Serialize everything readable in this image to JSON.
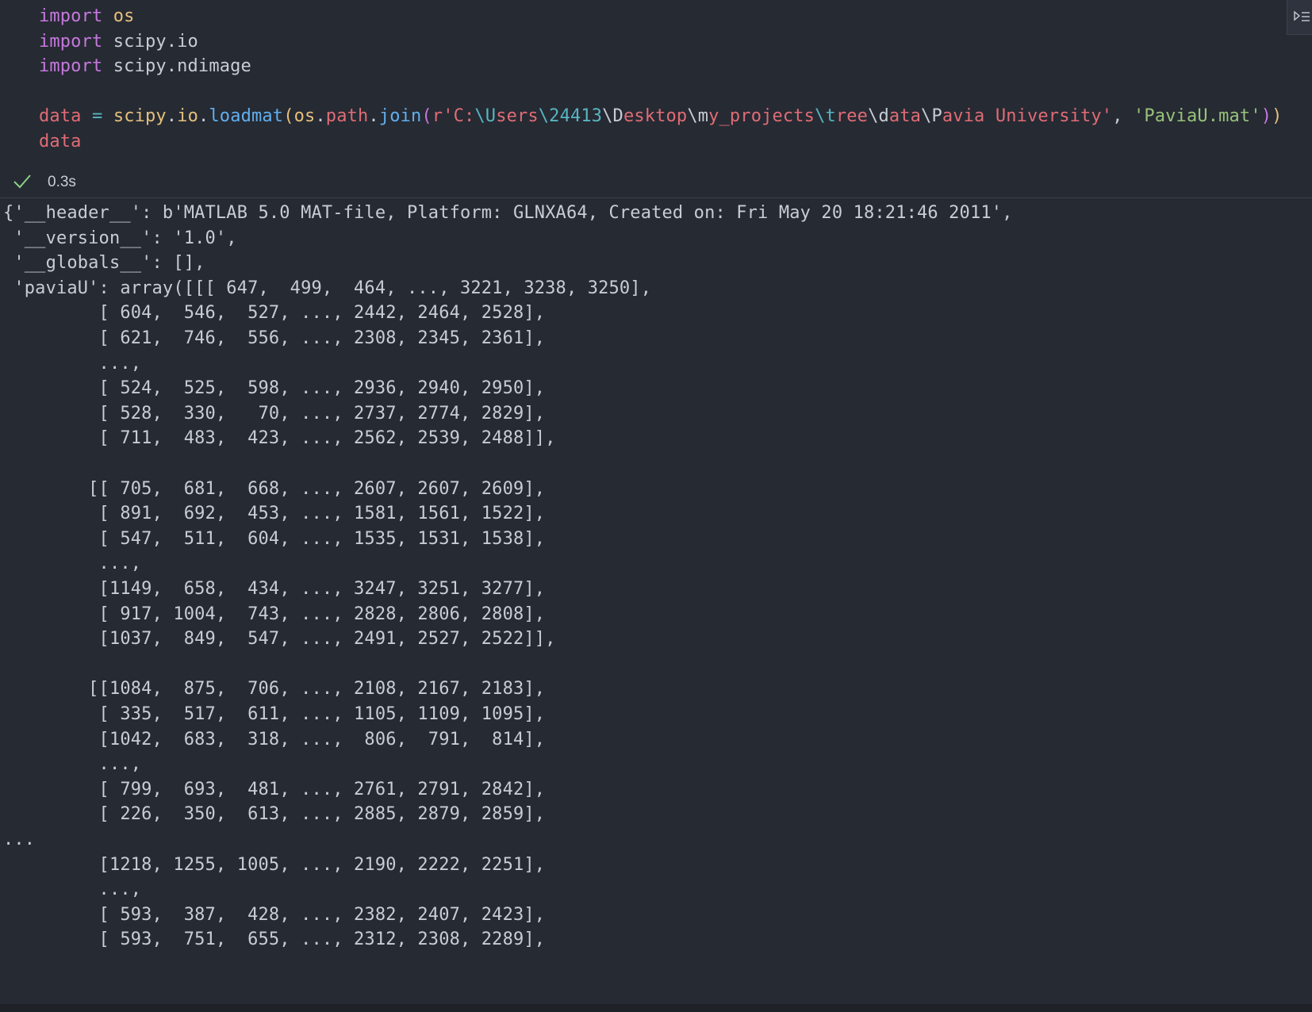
{
  "code_cell": {
    "lines": [
      {
        "tokens": [
          {
            "t": "import",
            "c": "kw"
          },
          {
            "t": " ",
            "c": "plain"
          },
          {
            "t": "os",
            "c": "mod"
          }
        ]
      },
      {
        "tokens": [
          {
            "t": "import",
            "c": "kw"
          },
          {
            "t": " scipy.io",
            "c": "plain"
          }
        ]
      },
      {
        "tokens": [
          {
            "t": "import",
            "c": "kw"
          },
          {
            "t": " scipy.ndimage",
            "c": "plain"
          }
        ]
      },
      {
        "tokens": []
      },
      {
        "tokens": [
          {
            "t": "data",
            "c": "var"
          },
          {
            "t": " ",
            "c": "plain"
          },
          {
            "t": "=",
            "c": "op"
          },
          {
            "t": " ",
            "c": "plain"
          },
          {
            "t": "scipy",
            "c": "mod"
          },
          {
            "t": ".",
            "c": "plain"
          },
          {
            "t": "io",
            "c": "mod"
          },
          {
            "t": ".",
            "c": "plain"
          },
          {
            "t": "loadmat",
            "c": "fn"
          },
          {
            "t": "(",
            "c": "p1"
          },
          {
            "t": "os",
            "c": "mod"
          },
          {
            "t": ".",
            "c": "plain"
          },
          {
            "t": "path",
            "c": "var"
          },
          {
            "t": ".",
            "c": "plain"
          },
          {
            "t": "join",
            "c": "fn"
          },
          {
            "t": "(",
            "c": "p2"
          },
          {
            "t": "r'C:",
            "c": "strp"
          },
          {
            "t": "\\U",
            "c": "esc"
          },
          {
            "t": "sers",
            "c": "strp"
          },
          {
            "t": "\\24413",
            "c": "esc"
          },
          {
            "t": "\\D",
            "c": "plain"
          },
          {
            "t": "esktop",
            "c": "strp"
          },
          {
            "t": "\\m",
            "c": "plain"
          },
          {
            "t": "y_projects",
            "c": "strp"
          },
          {
            "t": "\\t",
            "c": "esc"
          },
          {
            "t": "ree",
            "c": "strp"
          },
          {
            "t": "\\d",
            "c": "plain"
          },
          {
            "t": "ata",
            "c": "strp"
          },
          {
            "t": "\\P",
            "c": "plain"
          },
          {
            "t": "avia University'",
            "c": "strp"
          },
          {
            "t": ", ",
            "c": "plain"
          },
          {
            "t": "'PaviaU.mat'",
            "c": "str"
          },
          {
            "t": ")",
            "c": "p2"
          },
          {
            "t": ")",
            "c": "p1"
          }
        ]
      },
      {
        "tokens": [
          {
            "t": "data",
            "c": "var"
          }
        ]
      }
    ],
    "status_icon": "checkmark-icon",
    "exec_time": "0.3s",
    "toolbar_icon": "cell-toolbar-icon"
  },
  "output": {
    "lines": [
      "{'__header__': b'MATLAB 5.0 MAT-file, Platform: GLNXA64, Created on: Fri May 20 18:21:46 2011',",
      " '__version__': '1.0',",
      " '__globals__': [],",
      " 'paviaU': array([[[ 647,  499,  464, ..., 3221, 3238, 3250],",
      "         [ 604,  546,  527, ..., 2442, 2464, 2528],",
      "         [ 621,  746,  556, ..., 2308, 2345, 2361],",
      "         ...,",
      "         [ 524,  525,  598, ..., 2936, 2940, 2950],",
      "         [ 528,  330,   70, ..., 2737, 2774, 2829],",
      "         [ 711,  483,  423, ..., 2562, 2539, 2488]],",
      "",
      "        [[ 705,  681,  668, ..., 2607, 2607, 2609],",
      "         [ 891,  692,  453, ..., 1581, 1561, 1522],",
      "         [ 547,  511,  604, ..., 1535, 1531, 1538],",
      "         ...,",
      "         [1149,  658,  434, ..., 3247, 3251, 3277],",
      "         [ 917, 1004,  743, ..., 2828, 2806, 2808],",
      "         [1037,  849,  547, ..., 2491, 2527, 2522]],",
      "",
      "        [[1084,  875,  706, ..., 2108, 2167, 2183],",
      "         [ 335,  517,  611, ..., 1105, 1109, 1095],",
      "         [1042,  683,  318, ...,  806,  791,  814],",
      "         ...,",
      "         [ 799,  693,  481, ..., 2761, 2791, 2842],",
      "         [ 226,  350,  613, ..., 2885, 2879, 2859],",
      "...",
      "         [1218, 1255, 1005, ..., 2190, 2222, 2251],",
      "         ...,",
      "         [ 593,  387,  428, ..., 2382, 2407, 2423],",
      "         [ 593,  751,  655, ..., 2312, 2308, 2289],"
    ]
  }
}
